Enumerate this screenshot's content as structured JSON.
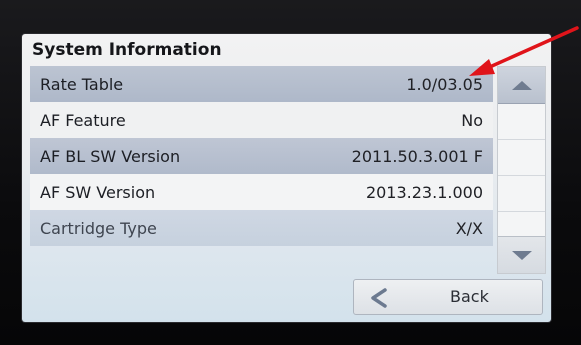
{
  "screen": {
    "title": "System Information"
  },
  "rows": [
    {
      "label": "Rate Table",
      "value": "1.0/03.05"
    },
    {
      "label": "AF Feature",
      "value": "No"
    },
    {
      "label": "AF BL SW Version",
      "value": "2011.50.3.001 F"
    },
    {
      "label": "AF SW Version",
      "value": "2013.23.1.000"
    },
    {
      "label": "Cartridge Type",
      "value": "X/X"
    }
  ],
  "scrollbar": {
    "up_icon": "triangle-up",
    "down_icon": "triangle-down"
  },
  "back_button": {
    "label": "Back",
    "icon": "chevron-left"
  },
  "colors": {
    "selected_row": "#b4bdcd",
    "annotation_arrow": "#e0141a",
    "chevron": "#6c7a90"
  }
}
